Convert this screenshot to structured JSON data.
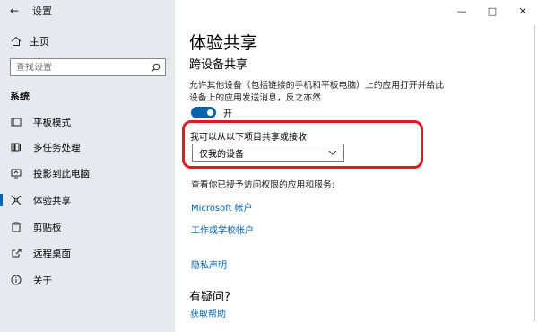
{
  "window": {
    "title": "设置"
  },
  "sidebar": {
    "home": "主页",
    "search_placeholder": "查找设置",
    "section": "系统",
    "items": [
      {
        "label": "平板模式",
        "icon": "tablet-icon"
      },
      {
        "label": "多任务处理",
        "icon": "multitask-icon"
      },
      {
        "label": "投影到此电脑",
        "icon": "project-icon"
      },
      {
        "label": "体验共享",
        "icon": "share-icon",
        "active": true
      },
      {
        "label": "剪贴板",
        "icon": "clipboard-icon"
      },
      {
        "label": "远程桌面",
        "icon": "remote-desktop-icon"
      },
      {
        "label": "关于",
        "icon": "info-icon"
      }
    ]
  },
  "main": {
    "title": "体验共享",
    "subtitle": "跨设备共享",
    "description": "允许其他设备（包括链接的手机和平板电脑）上的应用打开并给此设备上的应用发送消息，反之亦然",
    "toggle": {
      "label": "开",
      "on": true
    },
    "share_label": "我可以从以下项目共享或接收",
    "share_value": "仅我的设备",
    "apps_text": "查看你已授予访问权限的应用和服务:",
    "links": [
      "Microsoft 帐户",
      "工作或学校帐户",
      "隐私声明"
    ],
    "question": "有疑问?",
    "help_link": "获取帮助"
  },
  "colors": {
    "accent": "#0063b1",
    "highlight": "#e01a22",
    "sidebar_bg": "#e6eaef"
  }
}
